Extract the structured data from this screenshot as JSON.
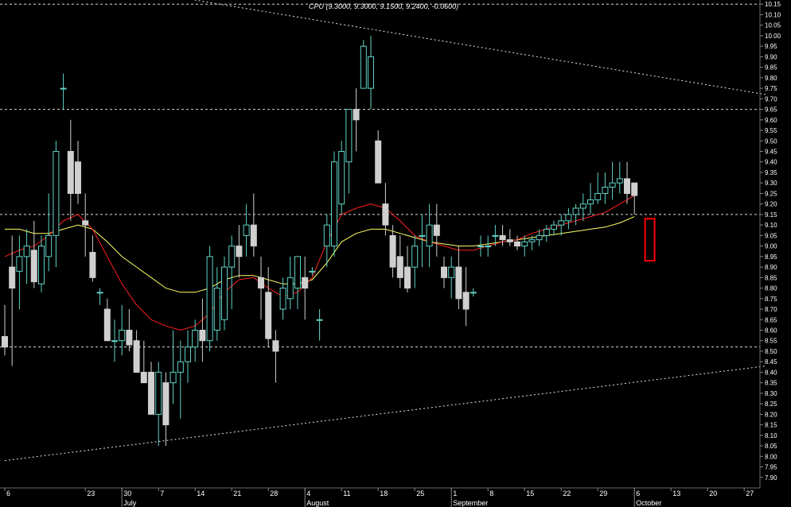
{
  "chart_data": {
    "type": "candlestick",
    "title": "CPU (9.3000, 9.3000, 9.1500, 9.2400, -0.0600)",
    "ylim": [
      7.85,
      10.2
    ],
    "yticks": [
      7.9,
      7.95,
      8.0,
      8.05,
      8.1,
      8.15,
      8.2,
      8.25,
      8.3,
      8.35,
      8.4,
      8.45,
      8.5,
      8.55,
      8.6,
      8.65,
      8.7,
      8.75,
      8.8,
      8.85,
      8.9,
      8.95,
      9.0,
      9.05,
      9.1,
      9.15,
      9.2,
      9.25,
      9.3,
      9.35,
      9.4,
      9.45,
      9.5,
      9.55,
      9.6,
      9.65,
      9.7,
      9.75,
      9.8,
      9.85,
      9.9,
      9.95,
      10.0,
      10.05,
      10.1,
      10.15
    ],
    "ytick_labels": [
      "7.90",
      "7.95",
      "8.00",
      "8.05",
      "8.10",
      "8.15",
      "8.20",
      "8.25",
      "8.30",
      "8.35",
      "8.40",
      "8.45",
      "8.50",
      "8.55",
      "8.60",
      "8.65",
      "8.70",
      "8.75",
      "8.80",
      "8.85",
      "8.90",
      "8.95",
      "9.00",
      "9.05",
      "9.10",
      "9.15",
      "9.20",
      "9.25",
      "9.30",
      "9.35",
      "9.40",
      "9.45",
      "9.50",
      "9.55",
      "9.60",
      "9.65",
      "9.70",
      "9.75",
      "9.80",
      "9.85",
      "9.90",
      "9.95",
      "10.00",
      "10.05",
      "10.10",
      "10.15"
    ],
    "xticks": [
      {
        "label": "6",
        "x": 0
      },
      {
        "label": "23",
        "x": 11
      },
      {
        "label": "30",
        "x": 16
      },
      {
        "label": "7",
        "x": 21
      },
      {
        "label": "14",
        "x": 26
      },
      {
        "label": "21",
        "x": 31
      },
      {
        "label": "28",
        "x": 36
      },
      {
        "label": "4",
        "x": 41
      },
      {
        "label": "11",
        "x": 46
      },
      {
        "label": "18",
        "x": 51
      },
      {
        "label": "25",
        "x": 56
      },
      {
        "label": "1",
        "x": 61
      },
      {
        "label": "8",
        "x": 66
      },
      {
        "label": "15",
        "x": 71
      },
      {
        "label": "22",
        "x": 76
      },
      {
        "label": "29",
        "x": 81
      },
      {
        "label": "6",
        "x": 86
      },
      {
        "label": "13",
        "x": 91
      },
      {
        "label": "20",
        "x": 96
      },
      {
        "label": "27",
        "x": 101
      }
    ],
    "months": [
      {
        "label": "July",
        "x": 16
      },
      {
        "label": "August",
        "x": 41
      },
      {
        "label": "September",
        "x": 61
      },
      {
        "label": "October",
        "x": 86
      }
    ],
    "hlines": [
      10.15,
      9.65,
      9.15,
      8.52
    ],
    "trendlines": [
      {
        "x1": 12,
        "y1": 10.25,
        "x2": 104,
        "y2": 9.72
      },
      {
        "x1": 0,
        "y1": 7.98,
        "x2": 104,
        "y2": 8.43
      }
    ],
    "box": {
      "x": 88,
      "y_low": 8.93,
      "y_high": 9.13,
      "color": "#ff0000"
    },
    "candles": [
      {
        "x": 0,
        "o": 8.57,
        "h": 8.72,
        "l": 8.48,
        "c": 8.52
      },
      {
        "x": 1,
        "o": 8.9,
        "h": 9.05,
        "l": 8.43,
        "c": 8.8
      },
      {
        "x": 2,
        "o": 8.88,
        "h": 9.05,
        "l": 8.7,
        "c": 8.95
      },
      {
        "x": 3,
        "o": 8.95,
        "h": 9.08,
        "l": 8.82,
        "c": 9.0
      },
      {
        "x": 4,
        "o": 8.98,
        "h": 9.12,
        "l": 8.8,
        "c": 8.83
      },
      {
        "x": 5,
        "o": 8.82,
        "h": 9.05,
        "l": 8.78,
        "c": 9.0
      },
      {
        "x": 6,
        "o": 8.95,
        "h": 9.25,
        "l": 8.88,
        "c": 9.05
      },
      {
        "x": 7,
        "o": 9.05,
        "h": 9.5,
        "l": 8.9,
        "c": 9.45
      },
      {
        "x": 8,
        "o": 9.75,
        "h": 9.82,
        "l": 9.65,
        "c": 9.75
      },
      {
        "x": 9,
        "o": 9.45,
        "h": 9.6,
        "l": 9.12,
        "c": 9.25
      },
      {
        "x": 10,
        "o": 9.4,
        "h": 9.5,
        "l": 9.2,
        "c": 9.25
      },
      {
        "x": 11,
        "o": 9.12,
        "h": 9.25,
        "l": 8.95,
        "c": 9.1
      },
      {
        "x": 12,
        "o": 8.97,
        "h": 9.05,
        "l": 8.83,
        "c": 8.85
      },
      {
        "x": 13,
        "o": 8.78,
        "h": 8.8,
        "l": 8.72,
        "c": 8.78
      },
      {
        "x": 14,
        "o": 8.7,
        "h": 8.75,
        "l": 8.55,
        "c": 8.55
      },
      {
        "x": 15,
        "o": 8.55,
        "h": 8.65,
        "l": 8.45,
        "c": 8.55
      },
      {
        "x": 16,
        "o": 8.55,
        "h": 8.72,
        "l": 8.48,
        "c": 8.6
      },
      {
        "x": 17,
        "o": 8.6,
        "h": 8.7,
        "l": 8.5,
        "c": 8.53
      },
      {
        "x": 18,
        "o": 8.55,
        "h": 8.6,
        "l": 8.45,
        "c": 8.4
      },
      {
        "x": 19,
        "o": 8.4,
        "h": 8.55,
        "l": 8.35,
        "c": 8.35
      },
      {
        "x": 20,
        "o": 8.4,
        "h": 8.45,
        "l": 8.22,
        "c": 8.2
      },
      {
        "x": 21,
        "o": 8.2,
        "h": 8.45,
        "l": 8.05,
        "c": 8.4
      },
      {
        "x": 22,
        "o": 8.35,
        "h": 8.4,
        "l": 8.05,
        "c": 8.15
      },
      {
        "x": 23,
        "o": 8.35,
        "h": 8.6,
        "l": 8.25,
        "c": 8.4
      },
      {
        "x": 24,
        "o": 8.4,
        "h": 8.55,
        "l": 8.18,
        "c": 8.45
      },
      {
        "x": 25,
        "o": 8.45,
        "h": 8.6,
        "l": 8.35,
        "c": 8.52
      },
      {
        "x": 26,
        "o": 8.52,
        "h": 8.65,
        "l": 8.45,
        "c": 8.6
      },
      {
        "x": 27,
        "o": 8.6,
        "h": 8.75,
        "l": 8.45,
        "c": 8.55
      },
      {
        "x": 28,
        "o": 8.55,
        "h": 9.0,
        "l": 8.5,
        "c": 8.95
      },
      {
        "x": 29,
        "o": 8.6,
        "h": 8.9,
        "l": 8.55,
        "c": 8.8
      },
      {
        "x": 30,
        "o": 8.65,
        "h": 8.95,
        "l": 8.6,
        "c": 8.9
      },
      {
        "x": 31,
        "o": 8.9,
        "h": 9.05,
        "l": 8.7,
        "c": 9.0
      },
      {
        "x": 32,
        "o": 9.0,
        "h": 9.1,
        "l": 8.85,
        "c": 8.95
      },
      {
        "x": 33,
        "o": 9.05,
        "h": 9.2,
        "l": 8.95,
        "c": 9.1
      },
      {
        "x": 34,
        "o": 9.1,
        "h": 9.25,
        "l": 8.95,
        "c": 9.0
      },
      {
        "x": 35,
        "o": 8.85,
        "h": 8.95,
        "l": 8.65,
        "c": 8.8
      },
      {
        "x": 36,
        "o": 8.78,
        "h": 8.9,
        "l": 8.52,
        "c": 8.56
      },
      {
        "x": 37,
        "o": 8.55,
        "h": 8.6,
        "l": 8.35,
        "c": 8.5
      },
      {
        "x": 38,
        "o": 8.7,
        "h": 8.85,
        "l": 8.65,
        "c": 8.8
      },
      {
        "x": 39,
        "o": 8.75,
        "h": 8.95,
        "l": 8.7,
        "c": 8.85
      },
      {
        "x": 40,
        "o": 8.8,
        "h": 8.9,
        "l": 8.7,
        "c": 8.95
      },
      {
        "x": 41,
        "o": 8.85,
        "h": 8.95,
        "l": 8.65,
        "c": 8.8
      },
      {
        "x": 42,
        "o": 8.88,
        "h": 8.9,
        "l": 8.86,
        "c": 8.88
      },
      {
        "x": 43,
        "o": 8.65,
        "h": 8.7,
        "l": 8.55,
        "c": 8.65
      },
      {
        "x": 44,
        "o": 9.0,
        "h": 9.15,
        "l": 8.9,
        "c": 9.1
      },
      {
        "x": 45,
        "o": 9.0,
        "h": 9.45,
        "l": 8.95,
        "c": 9.4
      },
      {
        "x": 46,
        "o": 9.2,
        "h": 9.5,
        "l": 9.15,
        "c": 9.45
      },
      {
        "x": 47,
        "o": 9.4,
        "h": 9.6,
        "l": 9.25,
        "c": 9.65
      },
      {
        "x": 48,
        "o": 9.65,
        "h": 9.75,
        "l": 9.45,
        "c": 9.6
      },
      {
        "x": 49,
        "o": 9.75,
        "h": 9.98,
        "l": 9.75,
        "c": 9.95
      },
      {
        "x": 50,
        "o": 9.75,
        "h": 10.0,
        "l": 9.65,
        "c": 9.9
      },
      {
        "x": 51,
        "o": 9.5,
        "h": 9.55,
        "l": 9.3,
        "c": 9.3
      },
      {
        "x": 52,
        "o": 9.2,
        "h": 9.3,
        "l": 9.05,
        "c": 9.1
      },
      {
        "x": 53,
        "o": 9.05,
        "h": 9.1,
        "l": 8.85,
        "c": 8.9
      },
      {
        "x": 54,
        "o": 8.95,
        "h": 9.05,
        "l": 8.8,
        "c": 8.85
      },
      {
        "x": 55,
        "o": 8.9,
        "h": 9.0,
        "l": 8.78,
        "c": 8.8
      },
      {
        "x": 56,
        "o": 8.9,
        "h": 9.05,
        "l": 8.8,
        "c": 9.0
      },
      {
        "x": 57,
        "o": 9.05,
        "h": 9.15,
        "l": 8.9,
        "c": 9.05
      },
      {
        "x": 58,
        "o": 9.0,
        "h": 9.2,
        "l": 8.9,
        "c": 9.1
      },
      {
        "x": 59,
        "o": 9.1,
        "h": 9.2,
        "l": 8.95,
        "c": 9.05
      },
      {
        "x": 60,
        "o": 8.9,
        "h": 8.95,
        "l": 8.8,
        "c": 8.85
      },
      {
        "x": 61,
        "o": 8.85,
        "h": 8.95,
        "l": 8.75,
        "c": 8.9
      },
      {
        "x": 62,
        "o": 8.9,
        "h": 9.0,
        "l": 8.7,
        "c": 8.75
      },
      {
        "x": 63,
        "o": 8.78,
        "h": 8.9,
        "l": 8.62,
        "c": 8.7
      },
      {
        "x": 64,
        "o": 8.78,
        "h": 8.8,
        "l": 8.76,
        "c": 8.78
      },
      {
        "x": 65,
        "o": 9.0,
        "h": 9.05,
        "l": 8.95,
        "c": 9.0
      },
      {
        "x": 66,
        "o": 9.0,
        "h": 9.05,
        "l": 8.95,
        "c": 9.0
      },
      {
        "x": 67,
        "o": 9.05,
        "h": 9.1,
        "l": 9.0,
        "c": 9.05
      },
      {
        "x": 68,
        "o": 9.05,
        "h": 9.1,
        "l": 9.0,
        "c": 9.03
      },
      {
        "x": 69,
        "o": 9.03,
        "h": 9.08,
        "l": 9.0,
        "c": 9.02
      },
      {
        "x": 70,
        "o": 9.02,
        "h": 9.05,
        "l": 8.98,
        "c": 9.0
      },
      {
        "x": 71,
        "o": 9.0,
        "h": 9.05,
        "l": 8.95,
        "c": 9.02
      },
      {
        "x": 72,
        "o": 9.02,
        "h": 9.05,
        "l": 8.98,
        "c": 9.03
      },
      {
        "x": 73,
        "o": 9.03,
        "h": 9.08,
        "l": 9.0,
        "c": 9.05
      },
      {
        "x": 74,
        "o": 9.05,
        "h": 9.1,
        "l": 9.02,
        "c": 9.08
      },
      {
        "x": 75,
        "o": 9.08,
        "h": 9.12,
        "l": 9.05,
        "c": 9.1
      },
      {
        "x": 76,
        "o": 9.1,
        "h": 9.15,
        "l": 9.05,
        "c": 9.12
      },
      {
        "x": 77,
        "o": 9.12,
        "h": 9.18,
        "l": 9.08,
        "c": 9.15
      },
      {
        "x": 78,
        "o": 9.15,
        "h": 9.2,
        "l": 9.1,
        "c": 9.18
      },
      {
        "x": 79,
        "o": 9.18,
        "h": 9.25,
        "l": 9.12,
        "c": 9.2
      },
      {
        "x": 80,
        "o": 9.2,
        "h": 9.3,
        "l": 9.15,
        "c": 9.22
      },
      {
        "x": 81,
        "o": 9.22,
        "h": 9.35,
        "l": 9.2,
        "c": 9.25
      },
      {
        "x": 82,
        "o": 9.25,
        "h": 9.35,
        "l": 9.2,
        "c": 9.28
      },
      {
        "x": 83,
        "o": 9.28,
        "h": 9.4,
        "l": 9.22,
        "c": 9.3
      },
      {
        "x": 84,
        "o": 9.3,
        "h": 9.4,
        "l": 9.25,
        "c": 9.32
      },
      {
        "x": 85,
        "o": 9.32,
        "h": 9.4,
        "l": 9.2,
        "c": 9.25
      },
      {
        "x": 86,
        "o": 9.3,
        "h": 9.3,
        "l": 9.15,
        "c": 9.24
      }
    ],
    "ma_fast": [
      [
        0,
        8.95
      ],
      [
        2,
        8.98
      ],
      [
        4,
        9.0
      ],
      [
        6,
        9.05
      ],
      [
        8,
        9.12
      ],
      [
        10,
        9.15
      ],
      [
        12,
        9.08
      ],
      [
        14,
        8.95
      ],
      [
        16,
        8.82
      ],
      [
        18,
        8.72
      ],
      [
        20,
        8.65
      ],
      [
        22,
        8.62
      ],
      [
        24,
        8.6
      ],
      [
        26,
        8.62
      ],
      [
        28,
        8.68
      ],
      [
        30,
        8.78
      ],
      [
        32,
        8.84
      ],
      [
        34,
        8.85
      ],
      [
        36,
        8.8
      ],
      [
        38,
        8.76
      ],
      [
        40,
        8.78
      ],
      [
        42,
        8.85
      ],
      [
        44,
        9.02
      ],
      [
        46,
        9.15
      ],
      [
        48,
        9.18
      ],
      [
        50,
        9.2
      ],
      [
        52,
        9.18
      ],
      [
        54,
        9.12
      ],
      [
        56,
        9.05
      ],
      [
        58,
        9.02
      ],
      [
        60,
        9.0
      ],
      [
        62,
        8.98
      ],
      [
        64,
        8.98
      ],
      [
        66,
        9.0
      ],
      [
        68,
        9.02
      ],
      [
        70,
        9.03
      ],
      [
        72,
        9.06
      ],
      [
        74,
        9.08
      ],
      [
        76,
        9.1
      ],
      [
        78,
        9.12
      ],
      [
        80,
        9.14
      ],
      [
        82,
        9.16
      ],
      [
        84,
        9.2
      ],
      [
        86,
        9.24
      ]
    ],
    "ma_slow": [
      [
        0,
        9.08
      ],
      [
        2,
        9.08
      ],
      [
        4,
        9.06
      ],
      [
        6,
        9.06
      ],
      [
        8,
        9.08
      ],
      [
        10,
        9.1
      ],
      [
        12,
        9.08
      ],
      [
        14,
        9.02
      ],
      [
        16,
        8.95
      ],
      [
        18,
        8.9
      ],
      [
        20,
        8.85
      ],
      [
        22,
        8.8
      ],
      [
        24,
        8.78
      ],
      [
        26,
        8.78
      ],
      [
        28,
        8.8
      ],
      [
        30,
        8.84
      ],
      [
        32,
        8.86
      ],
      [
        34,
        8.86
      ],
      [
        36,
        8.84
      ],
      [
        38,
        8.82
      ],
      [
        40,
        8.82
      ],
      [
        42,
        8.84
      ],
      [
        44,
        8.92
      ],
      [
        46,
        9.02
      ],
      [
        48,
        9.06
      ],
      [
        50,
        9.08
      ],
      [
        52,
        9.08
      ],
      [
        54,
        9.06
      ],
      [
        56,
        9.04
      ],
      [
        58,
        9.02
      ],
      [
        60,
        9.01
      ],
      [
        62,
        9.0
      ],
      [
        64,
        9.0
      ],
      [
        66,
        9.01
      ],
      [
        68,
        9.02
      ],
      [
        70,
        9.03
      ],
      [
        72,
        9.04
      ],
      [
        74,
        9.05
      ],
      [
        76,
        9.06
      ],
      [
        78,
        9.07
      ],
      [
        80,
        9.08
      ],
      [
        82,
        9.09
      ],
      [
        84,
        9.11
      ],
      [
        86,
        9.14
      ]
    ]
  }
}
